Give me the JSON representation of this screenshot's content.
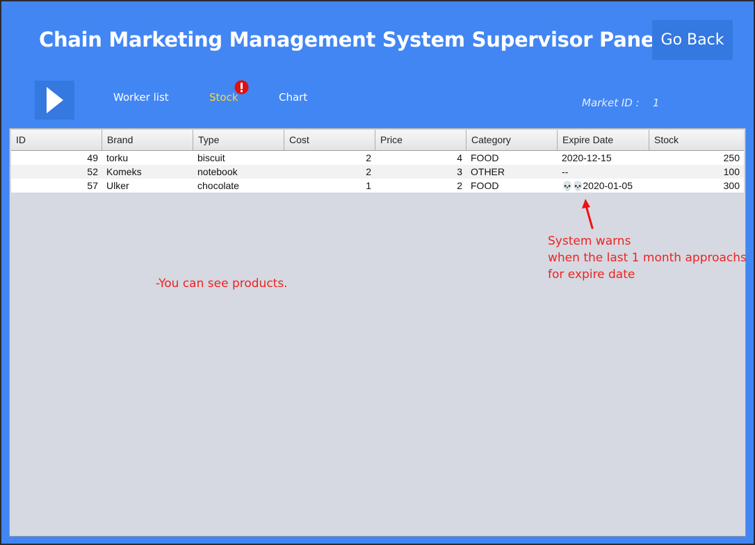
{
  "header": {
    "title": "Chain Marketing Management System Supervisor Panel",
    "go_back_label": "Go Back"
  },
  "nav": {
    "worker_list": "Worker list",
    "stock": "Stock",
    "chart": "Chart",
    "market_id_label": "Market ID :",
    "market_id_value": "1"
  },
  "table": {
    "columns": [
      "ID",
      "Brand",
      "Type",
      "Cost",
      "Price",
      "Category",
      "Expire Date",
      "Stock"
    ],
    "rows": [
      {
        "id": "49",
        "brand": "torku",
        "type": "biscuit",
        "cost": "2",
        "price": "4",
        "category": "FOOD",
        "expire_warning": "",
        "expire": "2020-12-15",
        "stock": "250"
      },
      {
        "id": "52",
        "brand": "Komeks",
        "type": "notebook",
        "cost": "2",
        "price": "3",
        "category": "OTHER",
        "expire_warning": "",
        "expire": "--",
        "stock": "100"
      },
      {
        "id": "57",
        "brand": "Ulker",
        "type": "chocolate",
        "cost": "1",
        "price": "2",
        "category": "FOOD",
        "expire_warning": "💀💀",
        "expire": "2020-01-05",
        "stock": "300"
      }
    ]
  },
  "annotations": {
    "products_note": "-You can see products.",
    "warn_line1": "System warns",
    "warn_line2": "when the last 1 month approachs",
    "warn_line3": "for expire date"
  },
  "colors": {
    "background": "#4286f4",
    "button": "#3478e0",
    "active_tab": "#ffd633",
    "annotation": "#ee2222"
  },
  "icons": {
    "play": "play-icon",
    "alert": "alert-icon",
    "skull": "skull-icon",
    "arrow": "arrow-icon"
  }
}
